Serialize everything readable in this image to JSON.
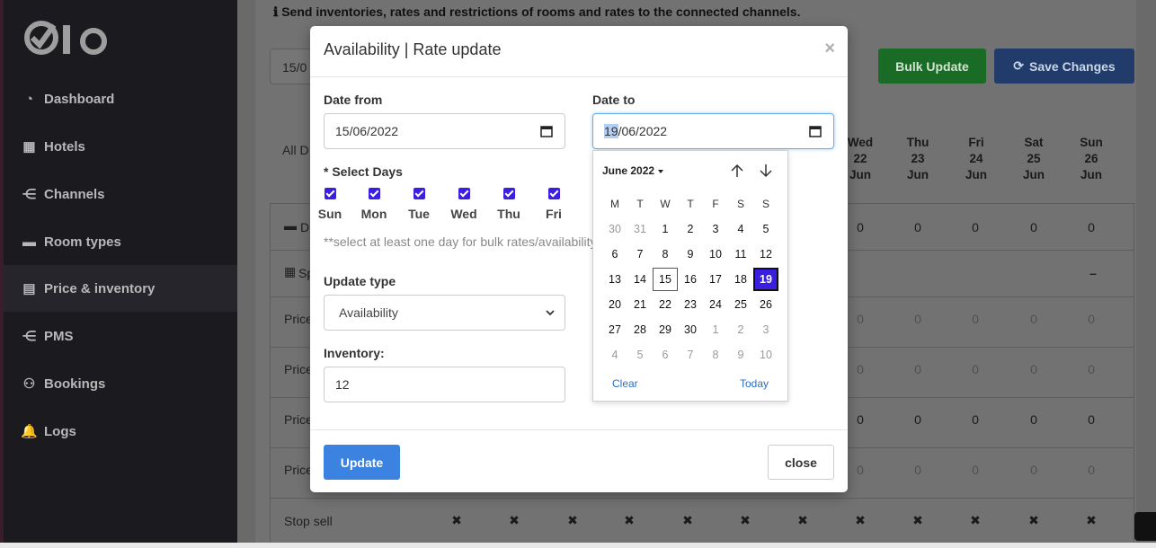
{
  "sidebar": {
    "items": [
      {
        "label": "Dashboard",
        "icon": "gauge-icon"
      },
      {
        "label": "Hotels",
        "icon": "building-icon"
      },
      {
        "label": "Channels",
        "icon": "share-nodes-icon"
      },
      {
        "label": "Room types",
        "icon": "bed-icon"
      },
      {
        "label": "Price & inventory",
        "icon": "clipboard-icon"
      },
      {
        "label": "PMS",
        "icon": "share-nodes-icon"
      },
      {
        "label": "Bookings",
        "icon": "users-icon"
      },
      {
        "label": "Logs",
        "icon": "bell-icon"
      }
    ]
  },
  "background": {
    "info_text": "Send inventories, rates and restrictions of rooms and rates to the connected channels.",
    "date_value": "15/0",
    "bulk_update": "Bulk Update",
    "save_changes": "Save Changes",
    "all_days_label": "All D",
    "day_columns": [
      {
        "dow": "Wed",
        "day": "22",
        "mon": "Jun"
      },
      {
        "dow": "Thu",
        "day": "23",
        "mon": "Jun"
      },
      {
        "dow": "Fri",
        "day": "24",
        "mon": "Jun"
      },
      {
        "dow": "Sat",
        "day": "25",
        "mon": "Jun"
      },
      {
        "dow": "Sun",
        "day": "26",
        "mon": "Jun"
      }
    ],
    "row_d": "D",
    "row_sp": "Sp",
    "minus": "–",
    "price_label": "Price",
    "stop_sell": "Stop sell",
    "zero": "0",
    "cross": "✖"
  },
  "modal": {
    "title": "Availability | Rate update",
    "close_x": "×",
    "date_from_label": "Date from",
    "date_from_value": "15/06/2022",
    "date_to_label": "Date to",
    "date_to_day": "19",
    "date_to_rest": "/06/2022",
    "select_days_label": "* Select Days",
    "days": [
      "Sun",
      "Mon",
      "Tue",
      "Wed",
      "Thu",
      "Fri"
    ],
    "hint": "**select at least one day for bulk rates/availability",
    "update_type_label": "Update type",
    "update_type_value": "Availability",
    "inventory_label": "Inventory:",
    "inventory_value": "12",
    "update_button": "Update",
    "close_button": "close"
  },
  "datepicker": {
    "month_label": "June 2022",
    "weekdays": [
      "M",
      "T",
      "W",
      "T",
      "F",
      "S",
      "S"
    ],
    "weeks": [
      [
        "30",
        "31",
        "1",
        "2",
        "3",
        "4",
        "5"
      ],
      [
        "6",
        "7",
        "8",
        "9",
        "10",
        "11",
        "12"
      ],
      [
        "13",
        "14",
        "15",
        "16",
        "17",
        "18",
        "19"
      ],
      [
        "20",
        "21",
        "22",
        "23",
        "24",
        "25",
        "26"
      ],
      [
        "27",
        "28",
        "29",
        "30",
        "1",
        "2",
        "3"
      ],
      [
        "4",
        "5",
        "6",
        "7",
        "8",
        "9",
        "10"
      ]
    ],
    "today": "15",
    "selected": "19",
    "clear": "Clear",
    "today_label": "Today"
  },
  "colors": {
    "accent": "#3b1fe0",
    "primary": "#3c82e0",
    "bulk_green": "#28a745",
    "save_blue": "#3a6fd8"
  }
}
